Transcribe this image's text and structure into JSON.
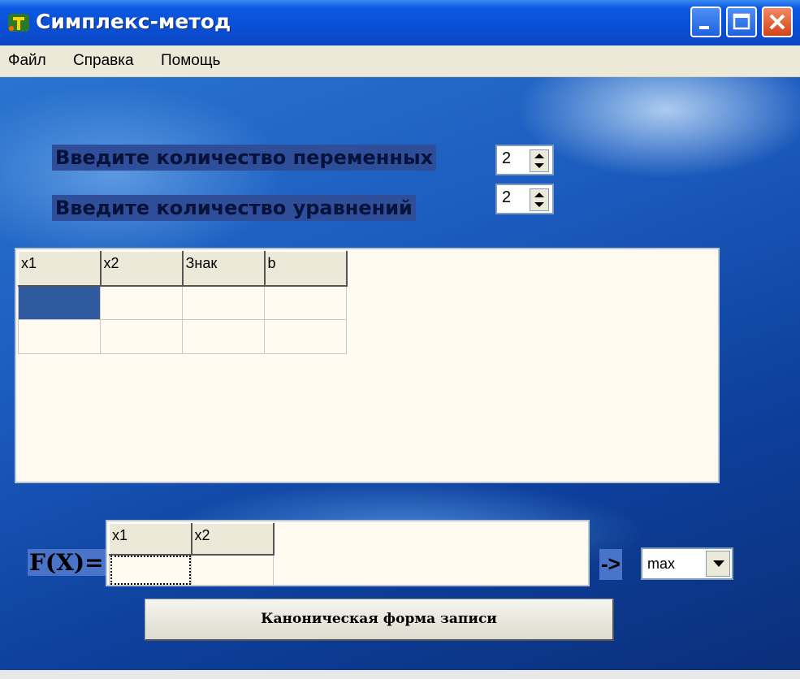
{
  "window": {
    "title": "Симплекс-метод"
  },
  "menu": {
    "items": [
      "Файл",
      "Справка",
      "Помощь"
    ]
  },
  "form": {
    "vars_label": "Введите количество  переменных",
    "vars_value": "2",
    "eq_label": "Введите количество уравнений",
    "eq_value": "2"
  },
  "constraints_grid": {
    "headers": [
      "x1",
      "x2",
      "Знак",
      "b"
    ],
    "rows": [
      [
        "",
        "",
        "",
        ""
      ],
      [
        "",
        "",
        "",
        ""
      ]
    ]
  },
  "objective": {
    "label": "F(X)=",
    "headers": [
      "x1",
      "x2"
    ],
    "row": [
      "",
      ""
    ],
    "arrow": "->",
    "direction": "max"
  },
  "canonical_button": "Каноническая форма записи",
  "colors": {
    "titlebar": "#0c58e0",
    "selection": "#2f5aa0",
    "grid_bg": "#fffbf0"
  }
}
